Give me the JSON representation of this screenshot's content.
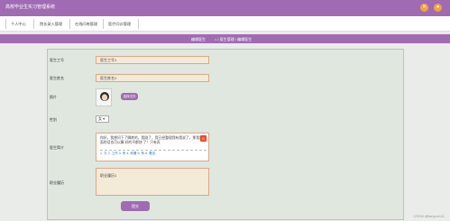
{
  "app": {
    "title": "高校毕业生实习管理系统"
  },
  "topbar": {
    "close_symbol": "✕",
    "user_symbol": "●"
  },
  "nav": {
    "items": [
      {
        "label": "个人中心"
      },
      {
        "label": "院长录入管理"
      },
      {
        "label": "在线问卷管理"
      },
      {
        "label": "医疗问诊管理"
      }
    ]
  },
  "breadcrumb": {
    "current": "编辑医生",
    "path": "⌂ / 医生管理 / 编辑医生"
  },
  "form": {
    "doctor_id_label": "医生工号",
    "doctor_id_value": "医生工号1",
    "doctor_name_label": "医生姓名",
    "doctor_name_value": "医生姓名1",
    "photo_label": "照片",
    "upload_label": "选择文件",
    "gender_label": "性别",
    "gender_value": "女 ▾",
    "intro_label": "医生简介",
    "intro_text": "你好，我想问下了脚疼的，我刚了，我已经整理我有我说了，那我后面的话也可以算 好的不都快 了！只有弄",
    "intro_ime": "1. 又   2. 工作    3. 来   4. 你看   5. 有   6. 看见",
    "ime_icon": "S",
    "position_label": "职业履历",
    "position_value": "职业履历1",
    "submit_label": "提交"
  },
  "watermark": "CSDN @fanyun111"
}
